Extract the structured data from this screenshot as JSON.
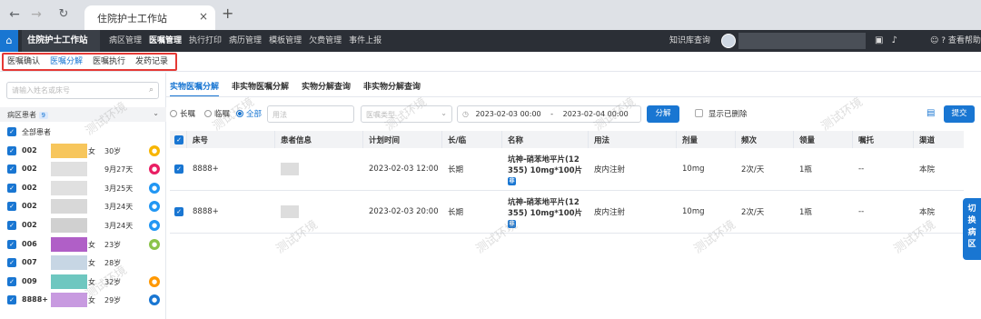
{
  "browser": {
    "tab_title": "住院护士工作站",
    "tab_close": "×",
    "new_tab": "+"
  },
  "app": {
    "station": "住院护士工作站",
    "menu": [
      "病区管理",
      "医嘱管理",
      "执行打印",
      "病历管理",
      "模板管理",
      "欠费管理",
      "事件上报"
    ],
    "active_menu": "医嘱管理",
    "kb_query": "知识库查询",
    "help": "查看帮助"
  },
  "subtabs": [
    "医嘱确认",
    "医嘱分解",
    "医嘱执行",
    "发药记录"
  ],
  "left": {
    "search_placeholder": "请输入姓名或床号",
    "ward_label": "病区患者",
    "ward_count": "9",
    "all_label": "全部患者",
    "patients": [
      {
        "bed": "002",
        "gender": "女",
        "age": "30岁",
        "color": "#f7b500"
      },
      {
        "bed": "002",
        "gender": "",
        "age": "9月27天",
        "color": "#e91e63"
      },
      {
        "bed": "002",
        "gender": "",
        "age": "3月25天",
        "color": "#2196f3"
      },
      {
        "bed": "002",
        "gender": "",
        "age": "3月24天",
        "color": "#2196f3"
      },
      {
        "bed": "002",
        "gender": "",
        "age": "3月24天",
        "color": "#2196f3"
      },
      {
        "bed": "006",
        "gender": "女",
        "age": "23岁",
        "color": "#8bc34a"
      },
      {
        "bed": "007",
        "gender": "女",
        "age": "28岁",
        "color": ""
      },
      {
        "bed": "009",
        "gender": "女",
        "age": "32岁",
        "color": "#ff9800"
      },
      {
        "bed": "8888+",
        "gender": "女",
        "age": "29岁",
        "color": "#1976d2"
      }
    ]
  },
  "main": {
    "tabs": [
      "实物医嘱分解",
      "非实物医嘱分解",
      "实物分解查询",
      "非实物分解查询"
    ],
    "filters": {
      "r1": "长嘱",
      "r2": "临嘱",
      "r3": "全部",
      "usage_placeholder": "用法",
      "type_placeholder": "医嘱类型",
      "date_start": "2023-02-03 00:00",
      "date_sep": "-",
      "date_end": "2023-02-04 00:00",
      "split_btn": "分解",
      "show_deleted": "显示已删除",
      "submit_btn": "提交"
    },
    "columns": [
      "床号",
      "患者信息",
      "计划时间",
      "长/临",
      "名称",
      "用法",
      "剂量",
      "频次",
      "领量",
      "嘱托",
      "渠道"
    ],
    "rows": [
      {
        "bed": "8888+",
        "time": "2023-02-03 12:00",
        "type": "长期",
        "name1": "坑神-硝苯地平片(12",
        "name2": "355) 10mg*100片",
        "tag": "非",
        "usage": "皮内注射",
        "dose": "10mg",
        "freq": "2次/天",
        "qty": "1瓶",
        "note": "--",
        "channel": "本院"
      },
      {
        "bed": "8888+",
        "time": "2023-02-03 20:00",
        "type": "长期",
        "name1": "坑神-硝苯地平片(12",
        "name2": "355) 10mg*100片",
        "tag": "非",
        "usage": "皮内注射",
        "dose": "10mg",
        "freq": "2次/天",
        "qty": "1瓶",
        "note": "--",
        "channel": "本院"
      }
    ],
    "side_button": "切换病区"
  },
  "watermark": "测试环境"
}
